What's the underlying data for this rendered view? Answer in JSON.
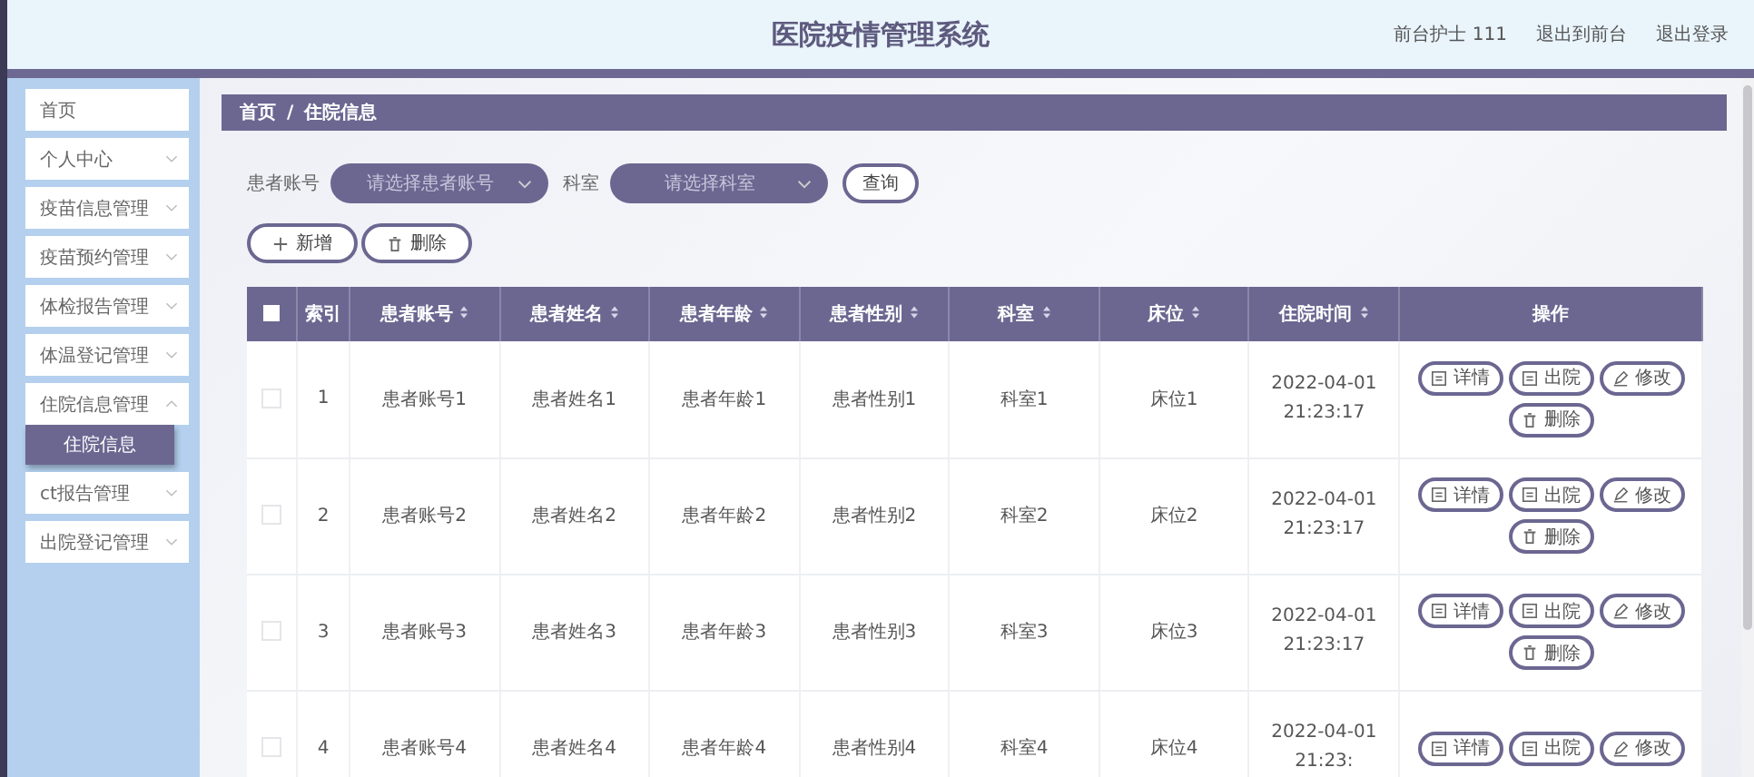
{
  "header": {
    "title": "医院疫情管理系统",
    "links": [
      "前台护士 111",
      "退出到前台",
      "退出登录"
    ]
  },
  "sidebar": {
    "items": [
      {
        "label": "首页",
        "kind": "link"
      },
      {
        "label": "个人中心",
        "kind": "menu",
        "expanded": false
      },
      {
        "label": "疫苗信息管理",
        "kind": "menu",
        "expanded": false
      },
      {
        "label": "疫苗预约管理",
        "kind": "menu",
        "expanded": false
      },
      {
        "label": "体检报告管理",
        "kind": "menu",
        "expanded": false
      },
      {
        "label": "体温登记管理",
        "kind": "menu",
        "expanded": false
      },
      {
        "label": "住院信息管理",
        "kind": "menu",
        "expanded": true,
        "children": [
          {
            "label": "住院信息",
            "selected": true
          }
        ]
      },
      {
        "label": "ct报告管理",
        "kind": "menu",
        "expanded": false
      },
      {
        "label": "出院登记管理",
        "kind": "menu",
        "expanded": false
      }
    ]
  },
  "breadcrumb": [
    "首页",
    "/",
    "住院信息"
  ],
  "search": {
    "fields": [
      {
        "label": "患者账号",
        "placeholder": "请选择患者账号"
      },
      {
        "label": "科室",
        "placeholder": "请选择科室"
      }
    ],
    "button": "查询"
  },
  "toolbar": [
    {
      "label": "新增",
      "kind": "add"
    },
    {
      "label": "删除",
      "kind": "delete"
    }
  ],
  "table": {
    "select_all": {
      "checked": false
    },
    "columns": [
      {
        "label": "索引",
        "sortable": false
      },
      {
        "label": "患者账号",
        "sortable": true
      },
      {
        "label": "患者姓名",
        "sortable": true
      },
      {
        "label": "患者年龄",
        "sortable": true
      },
      {
        "label": "患者性别",
        "sortable": true
      },
      {
        "label": "科室",
        "sortable": true
      },
      {
        "label": "床位",
        "sortable": true
      },
      {
        "label": "住院时间",
        "sortable": true
      },
      {
        "label": "操作",
        "sortable": false
      }
    ],
    "rows": [
      {
        "checked": false,
        "cells": [
          "1",
          "患者账号1",
          "患者姓名1",
          "患者年龄1",
          "患者性别1",
          "科室1",
          "床位1",
          "2022-04-01 21:23:17"
        ],
        "actions": [
          {
            "label": "详情",
            "kind": "detail"
          },
          {
            "label": "出院",
            "kind": "discharge"
          },
          {
            "label": "修改",
            "kind": "edit"
          },
          {
            "label": "删除",
            "kind": "delete"
          }
        ]
      },
      {
        "checked": false,
        "cells": [
          "2",
          "患者账号2",
          "患者姓名2",
          "患者年龄2",
          "患者性别2",
          "科室2",
          "床位2",
          "2022-04-01 21:23:17"
        ],
        "actions": [
          {
            "label": "详情",
            "kind": "detail"
          },
          {
            "label": "出院",
            "kind": "discharge"
          },
          {
            "label": "修改",
            "kind": "edit"
          },
          {
            "label": "删除",
            "kind": "delete"
          }
        ]
      },
      {
        "checked": false,
        "cells": [
          "3",
          "患者账号3",
          "患者姓名3",
          "患者年龄3",
          "患者性别3",
          "科室3",
          "床位3",
          "2022-04-01 21:23:17"
        ],
        "actions": [
          {
            "label": "详情",
            "kind": "detail"
          },
          {
            "label": "出院",
            "kind": "discharge"
          },
          {
            "label": "修改",
            "kind": "edit"
          },
          {
            "label": "删除",
            "kind": "delete"
          }
        ]
      },
      {
        "checked": false,
        "cells": [
          "4",
          "患者账号4",
          "患者姓名4",
          "患者年龄4",
          "患者性别4",
          "科室4",
          "床位4",
          "2022-04-01 21:23:"
        ],
        "actions": [
          {
            "label": "详情",
            "kind": "detail"
          },
          {
            "label": "出院",
            "kind": "discharge"
          },
          {
            "label": "修改",
            "kind": "edit"
          }
        ]
      }
    ]
  }
}
